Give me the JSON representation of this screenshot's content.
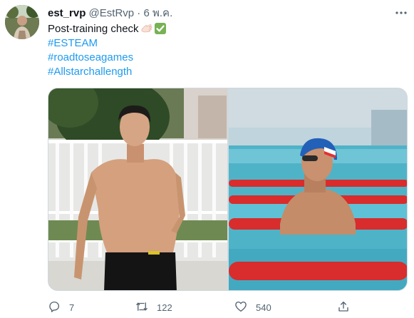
{
  "author": {
    "display_name": "est_rvp",
    "handle": "@EstRvp",
    "separator": "·",
    "timestamp": "6 พ.ค."
  },
  "tweet": {
    "text": "Post-training check",
    "hashtags": [
      "#ESTEAM",
      "#roadtoseagames",
      "#Allstarchallength"
    ]
  },
  "icons": {
    "more": "more-dots-icon",
    "emoji_1": "hand-icon",
    "emoji_2": "check-mark-icon",
    "reply": "reply-icon",
    "retweet": "retweet-icon",
    "like": "heart-icon",
    "share": "share-icon"
  },
  "actions": {
    "replies": "7",
    "retweets": "122",
    "likes": "540"
  },
  "colors": {
    "link": "#1d9bf0",
    "secondary_text": "#536471",
    "primary_text": "#0f1419",
    "check_emoji": "#77b255"
  }
}
